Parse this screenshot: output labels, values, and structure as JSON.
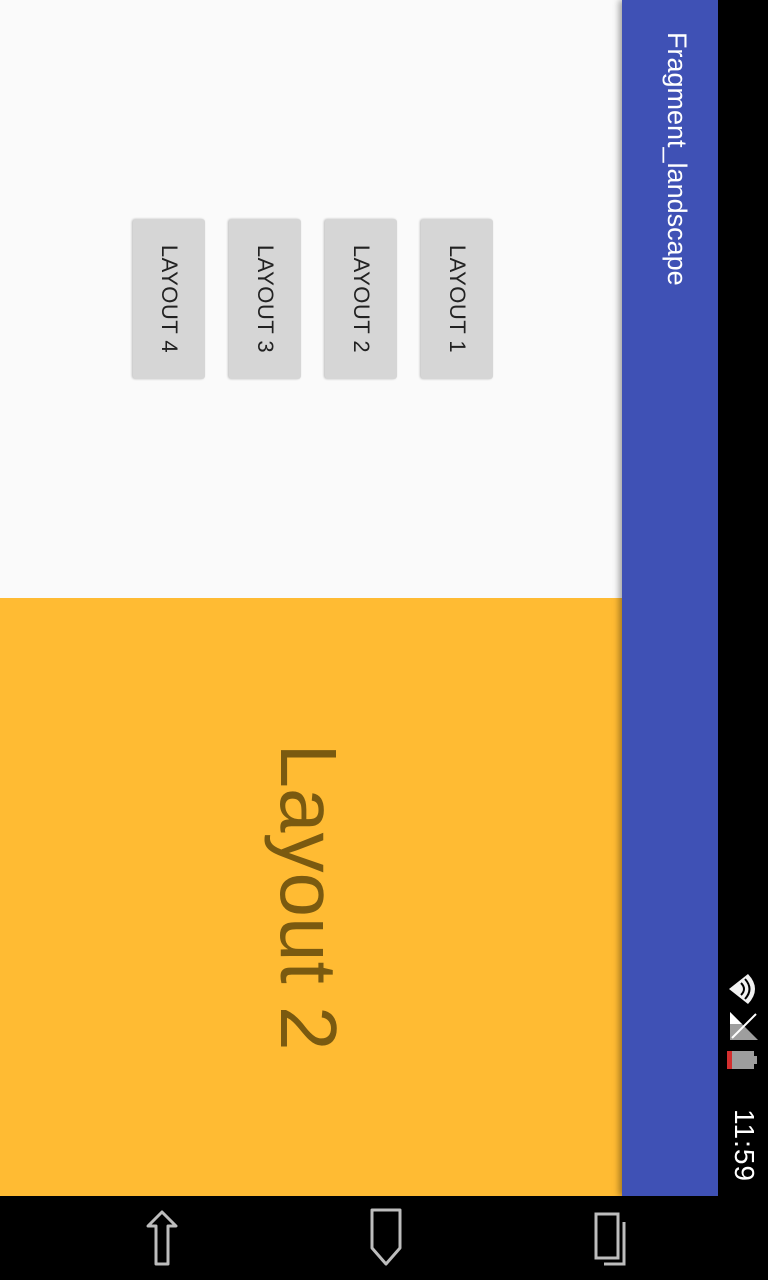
{
  "status_bar": {
    "time": "11:59",
    "icons": [
      "wifi-icon",
      "signal-icon",
      "battery-icon"
    ],
    "battery_color": "#d32f2f"
  },
  "app_bar": {
    "title": "Fragment_landscape",
    "color": "#3f51b5"
  },
  "buttons": [
    {
      "label": "LAYOUT 1"
    },
    {
      "label": "LAYOUT 2"
    },
    {
      "label": "LAYOUT 3"
    },
    {
      "label": "LAYOUT 4"
    }
  ],
  "fragment": {
    "text": "Layout 2",
    "background": "#ffbb33"
  },
  "nav_bar": {
    "icons": [
      "back-icon",
      "home-icon",
      "recents-icon"
    ]
  }
}
